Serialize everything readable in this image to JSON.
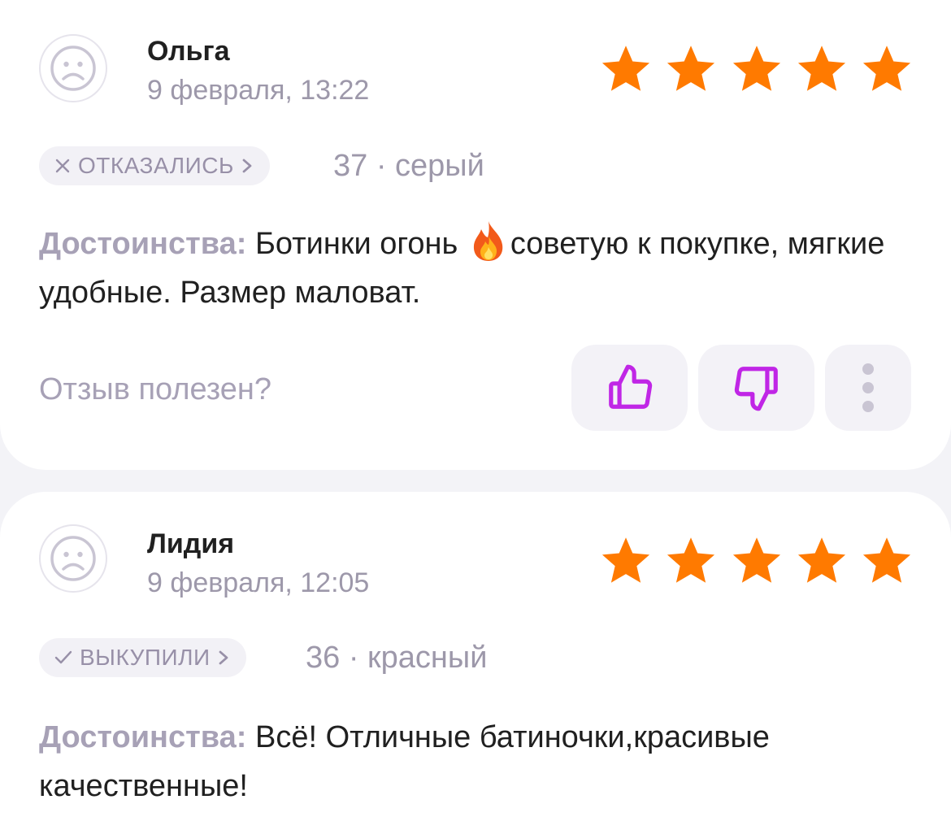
{
  "colors": {
    "star": "#ff7a00",
    "accent": "#c026e6",
    "muted": "#9d98aa",
    "label": "#a7a1b6",
    "text": "#202020",
    "pill_bg": "#f2f1f6"
  },
  "reviews": [
    {
      "name": "Ольга",
      "date": "9 февраля, 13:22",
      "rating": 5,
      "status": "ОТКАЗАЛИСЬ",
      "status_icon": "cross-icon",
      "meta": "37 · серый",
      "label": "Достоинства:",
      "text_before": "Ботинки огонь",
      "emoji": "fire-icon",
      "text_after": "советую к покупке, мягкие удобные. Размер маловат.",
      "helpful_question": "Отзыв полезен?"
    },
    {
      "name": "Лидия",
      "date": "9 февраля, 12:05",
      "rating": 5,
      "status": "ВЫКУПИЛИ",
      "status_icon": "checkmark-icon",
      "meta": "36 · красный",
      "label": "Достоинства:",
      "text": "Всё! Отличные батиночки,красивые качественные!"
    }
  ]
}
